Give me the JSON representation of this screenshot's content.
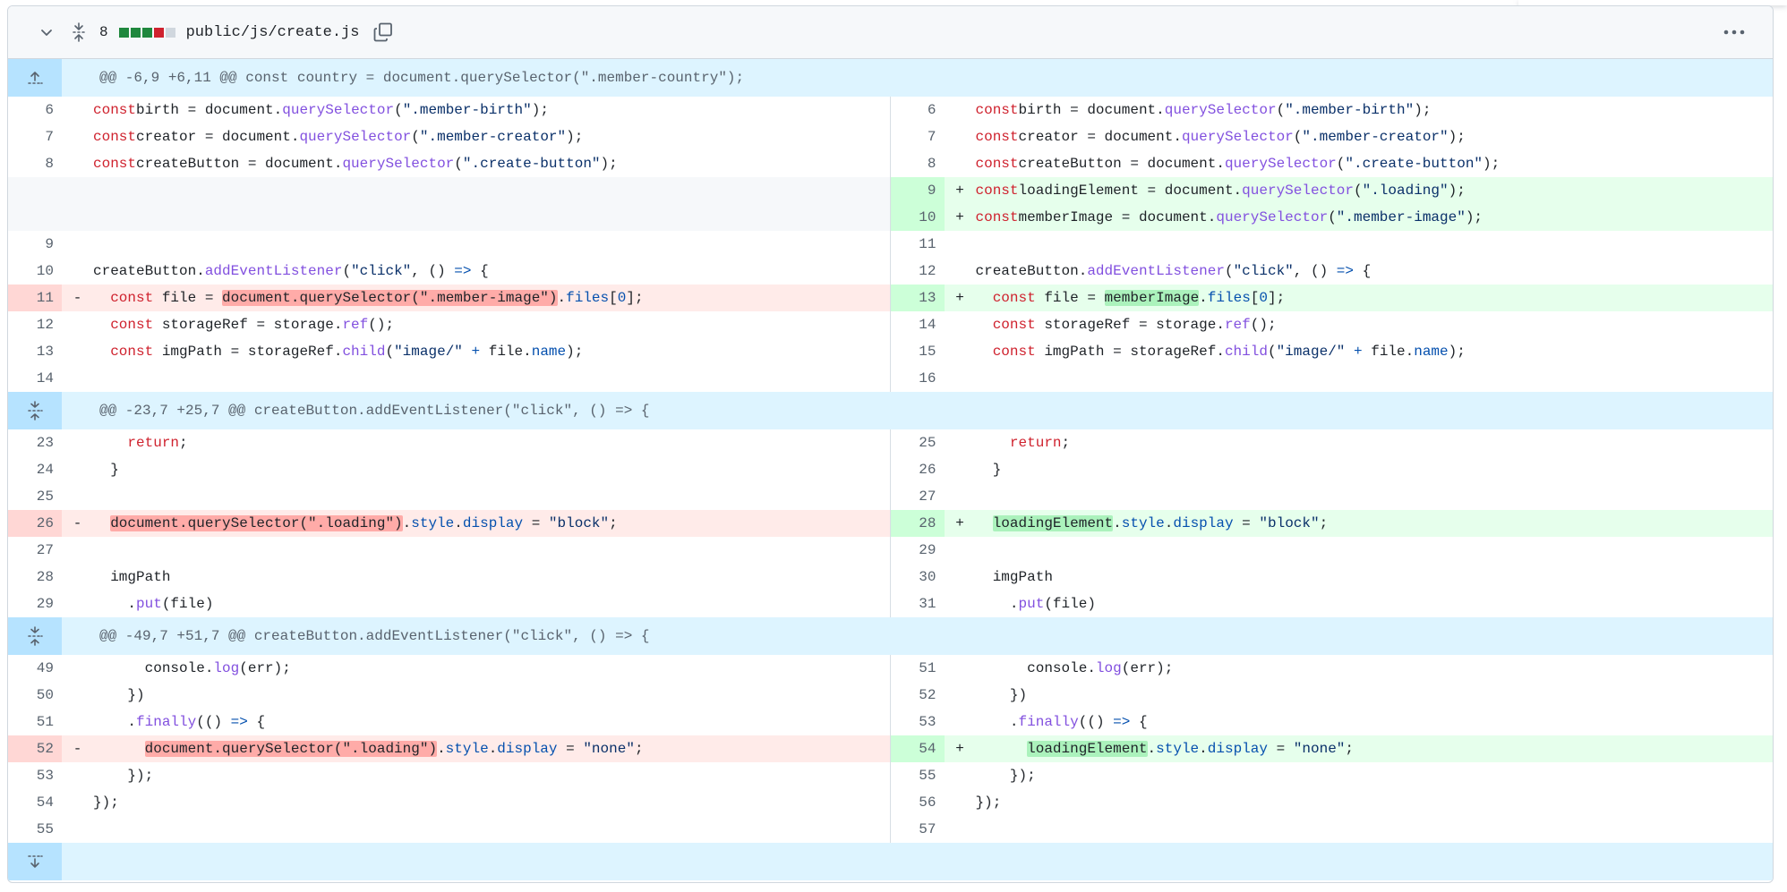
{
  "file": {
    "path": "public/js/create.js",
    "changes": "8",
    "diffstat_colors": [
      "#1f883d",
      "#1f883d",
      "#1f883d",
      "#cf222e",
      "#d0d7de"
    ]
  },
  "icons": {
    "collapse": "chevron-down-icon",
    "expand_all": "unfold-icon",
    "copy": "copy-icon",
    "more": "kebab-horizontal-icon"
  },
  "rows": [
    {
      "type": "hunk",
      "text": "@@ -6,9 +6,11 @@ const country = document.querySelector(\".member-country\");",
      "icon": "fold-up-icon"
    },
    {
      "type": "ctx",
      "l": "6",
      "r": "6",
      "code": [
        [
          "kw",
          "const"
        ],
        [
          "",
          "birth = document."
        ],
        [
          "fn",
          "querySelector"
        ],
        [
          "",
          "("
        ],
        [
          "str",
          "\".member-birth\""
        ],
        [
          "",
          ");"
        ]
      ]
    },
    {
      "type": "ctx",
      "l": "7",
      "r": "7",
      "code": [
        [
          "kw",
          "const"
        ],
        [
          "",
          "creator = document."
        ],
        [
          "fn",
          "querySelector"
        ],
        [
          "",
          "("
        ],
        [
          "str",
          "\".member-creator\""
        ],
        [
          "",
          ");"
        ]
      ]
    },
    {
      "type": "ctx",
      "l": "8",
      "r": "8",
      "code": [
        [
          "kw",
          "const"
        ],
        [
          "",
          "createButton = document."
        ],
        [
          "fn",
          "querySelector"
        ],
        [
          "",
          "("
        ],
        [
          "str",
          "\".create-button\""
        ],
        [
          "",
          ");"
        ]
      ]
    },
    {
      "type": "addonly",
      "r": "9",
      "code": [
        [
          "kw",
          "const"
        ],
        [
          "",
          "loadingElement = document."
        ],
        [
          "fn",
          "querySelector"
        ],
        [
          "",
          "("
        ],
        [
          "str",
          "\".loading\""
        ],
        [
          "",
          ");"
        ]
      ]
    },
    {
      "type": "addonly",
      "r": "10",
      "code": [
        [
          "kw",
          "const"
        ],
        [
          "",
          "memberImage = document."
        ],
        [
          "fn",
          "querySelector"
        ],
        [
          "",
          "("
        ],
        [
          "str",
          "\".member-image\""
        ],
        [
          "",
          ");"
        ]
      ]
    },
    {
      "type": "ctx",
      "l": "9",
      "r": "11",
      "code": []
    },
    {
      "type": "ctx",
      "l": "10",
      "r": "12",
      "code": [
        [
          "",
          "createButton."
        ],
        [
          "fn",
          "addEventListener"
        ],
        [
          "",
          "("
        ],
        [
          "str",
          "\"click\""
        ],
        [
          "",
          ", () "
        ],
        [
          "op",
          "=>"
        ],
        [
          "",
          " {"
        ]
      ]
    },
    {
      "type": "mod",
      "l": "11",
      "r": "13",
      "lcode": [
        [
          "",
          "  "
        ],
        [
          "kw",
          "const"
        ],
        [
          "",
          "",
          " "
        ],
        [
          "",
          "file = "
        ],
        [
          "hl-del",
          "document.querySelector(\".member-image\")"
        ],
        [
          "",
          "."
        ],
        [
          "prop",
          "files"
        ],
        [
          "",
          "["
        ],
        [
          "prop",
          "0"
        ],
        [
          "",
          "];"
        ]
      ],
      "rcode": [
        [
          "",
          "  "
        ],
        [
          "kw",
          "const"
        ],
        [
          "",
          "",
          " "
        ],
        [
          "",
          "file = "
        ],
        [
          "hl-add",
          "memberImage"
        ],
        [
          "",
          "."
        ],
        [
          "prop",
          "files"
        ],
        [
          "",
          "["
        ],
        [
          "prop",
          "0"
        ],
        [
          "",
          "];"
        ]
      ]
    },
    {
      "type": "ctx",
      "l": "12",
      "r": "14",
      "code": [
        [
          "",
          "  "
        ],
        [
          "kw",
          "const"
        ],
        [
          "",
          " storageRef = storage."
        ],
        [
          "fn",
          "ref"
        ],
        [
          "",
          "();"
        ]
      ]
    },
    {
      "type": "ctx",
      "l": "13",
      "r": "15",
      "code": [
        [
          "",
          "  "
        ],
        [
          "kw",
          "const"
        ],
        [
          "",
          " imgPath = storageRef."
        ],
        [
          "fn",
          "child"
        ],
        [
          "",
          "("
        ],
        [
          "str",
          "\"image/\""
        ],
        [
          "",
          " "
        ],
        [
          "op",
          "+"
        ],
        [
          "",
          " file."
        ],
        [
          "prop",
          "name"
        ],
        [
          "",
          ");"
        ]
      ]
    },
    {
      "type": "ctx",
      "l": "14",
      "r": "16",
      "code": []
    },
    {
      "type": "hunk",
      "text": "@@ -23,7 +25,7 @@ createButton.addEventListener(\"click\", () => {",
      "icon": "unfold-icon"
    },
    {
      "type": "ctx",
      "l": "23",
      "r": "25",
      "code": [
        [
          "",
          "    "
        ],
        [
          "kw",
          "return"
        ],
        [
          "",
          ";"
        ]
      ]
    },
    {
      "type": "ctx",
      "l": "24",
      "r": "26",
      "code": [
        [
          "",
          "  }"
        ]
      ]
    },
    {
      "type": "ctx",
      "l": "25",
      "r": "27",
      "code": []
    },
    {
      "type": "mod",
      "l": "26",
      "r": "28",
      "lcode": [
        [
          "",
          "  "
        ],
        [
          "hl-del",
          "document.querySelector(\".loading\")"
        ],
        [
          "",
          "."
        ],
        [
          "prop",
          "style"
        ],
        [
          "",
          "."
        ],
        [
          "prop",
          "display"
        ],
        [
          "",
          " = "
        ],
        [
          "str",
          "\"block\""
        ],
        [
          "",
          ";"
        ]
      ],
      "rcode": [
        [
          "",
          "  "
        ],
        [
          "hl-add",
          "loadingElement"
        ],
        [
          "",
          "."
        ],
        [
          "prop",
          "style"
        ],
        [
          "",
          "."
        ],
        [
          "prop",
          "display"
        ],
        [
          "",
          " = "
        ],
        [
          "str",
          "\"block\""
        ],
        [
          "",
          ";"
        ]
      ]
    },
    {
      "type": "ctx",
      "l": "27",
      "r": "29",
      "code": []
    },
    {
      "type": "ctx",
      "l": "28",
      "r": "30",
      "code": [
        [
          "",
          "  imgPath"
        ]
      ]
    },
    {
      "type": "ctx",
      "l": "29",
      "r": "31",
      "code": [
        [
          "",
          "    ."
        ],
        [
          "fn",
          "put"
        ],
        [
          "",
          "(file)"
        ]
      ]
    },
    {
      "type": "hunk",
      "text": "@@ -49,7 +51,7 @@ createButton.addEventListener(\"click\", () => {",
      "icon": "unfold-icon"
    },
    {
      "type": "ctx",
      "l": "49",
      "r": "51",
      "code": [
        [
          "",
          "      console."
        ],
        [
          "fn",
          "log"
        ],
        [
          "",
          "(err);"
        ]
      ]
    },
    {
      "type": "ctx",
      "l": "50",
      "r": "52",
      "code": [
        [
          "",
          "    })"
        ]
      ]
    },
    {
      "type": "ctx",
      "l": "51",
      "r": "53",
      "code": [
        [
          "",
          "    ."
        ],
        [
          "fn",
          "finally"
        ],
        [
          "",
          "(() "
        ],
        [
          "op",
          "=>"
        ],
        [
          "",
          " {"
        ]
      ]
    },
    {
      "type": "mod",
      "l": "52",
      "r": "54",
      "lcode": [
        [
          "",
          "      "
        ],
        [
          "hl-del",
          "document.querySelector(\".loading\")"
        ],
        [
          "",
          "."
        ],
        [
          "prop",
          "style"
        ],
        [
          "",
          "."
        ],
        [
          "prop",
          "display"
        ],
        [
          "",
          " = "
        ],
        [
          "str",
          "\"none\""
        ],
        [
          "",
          ";"
        ]
      ],
      "rcode": [
        [
          "",
          "      "
        ],
        [
          "hl-add",
          "loadingElement"
        ],
        [
          "",
          "."
        ],
        [
          "prop",
          "style"
        ],
        [
          "",
          "."
        ],
        [
          "prop",
          "display"
        ],
        [
          "",
          " = "
        ],
        [
          "str",
          "\"none\""
        ],
        [
          "",
          ";"
        ]
      ]
    },
    {
      "type": "ctx",
      "l": "53",
      "r": "55",
      "code": [
        [
          "",
          "    });"
        ]
      ]
    },
    {
      "type": "ctx",
      "l": "54",
      "r": "56",
      "code": [
        [
          "",
          "});"
        ]
      ]
    },
    {
      "type": "ctx",
      "l": "55",
      "r": "57",
      "code": []
    },
    {
      "type": "hunk-end",
      "icon": "fold-down-icon"
    }
  ],
  "markers": {
    "del": "-",
    "add": "+"
  }
}
